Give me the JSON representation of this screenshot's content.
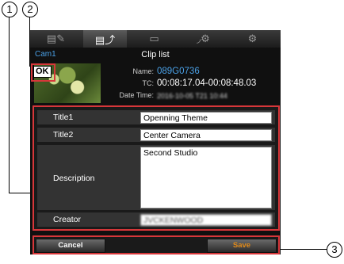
{
  "callouts": {
    "c1": "1",
    "c2": "2",
    "c3": "3"
  },
  "tabs": [
    {
      "icon": "▤✎",
      "name": "edit-clip-icon"
    },
    {
      "icon": "▤⤴",
      "name": "clip-list-icon"
    },
    {
      "icon": "▭",
      "name": "view-icon"
    },
    {
      "icon": "◞⚙",
      "name": "camera-settings-icon"
    },
    {
      "icon": "⚙",
      "name": "settings-gear-icon"
    }
  ],
  "header": {
    "camera": "Cam1",
    "title": "Clip list"
  },
  "clip": {
    "status_badge": "OK",
    "name_label": "Name:",
    "name_value": "089G0736",
    "tc_label": "TC:",
    "tc_value": "00:08:17.04-00:08:48.03",
    "date_label": "Date Time:",
    "date_value": "2016-10-05 T21 10:44"
  },
  "form": {
    "title1_label": "Title1",
    "title1_value": "Openning Theme",
    "title2_label": "Title2",
    "title2_value": "Center Camera",
    "description_label": "Description",
    "description_value": "Second Studio",
    "creator_label": "Creator",
    "creator_value": "JVCKENWOOD"
  },
  "buttons": {
    "cancel": "Cancel",
    "save": "Save"
  },
  "colors": {
    "highlight": "#d7373a",
    "accent_blue": "#4aa0e6",
    "save_orange": "#e08a1a"
  }
}
